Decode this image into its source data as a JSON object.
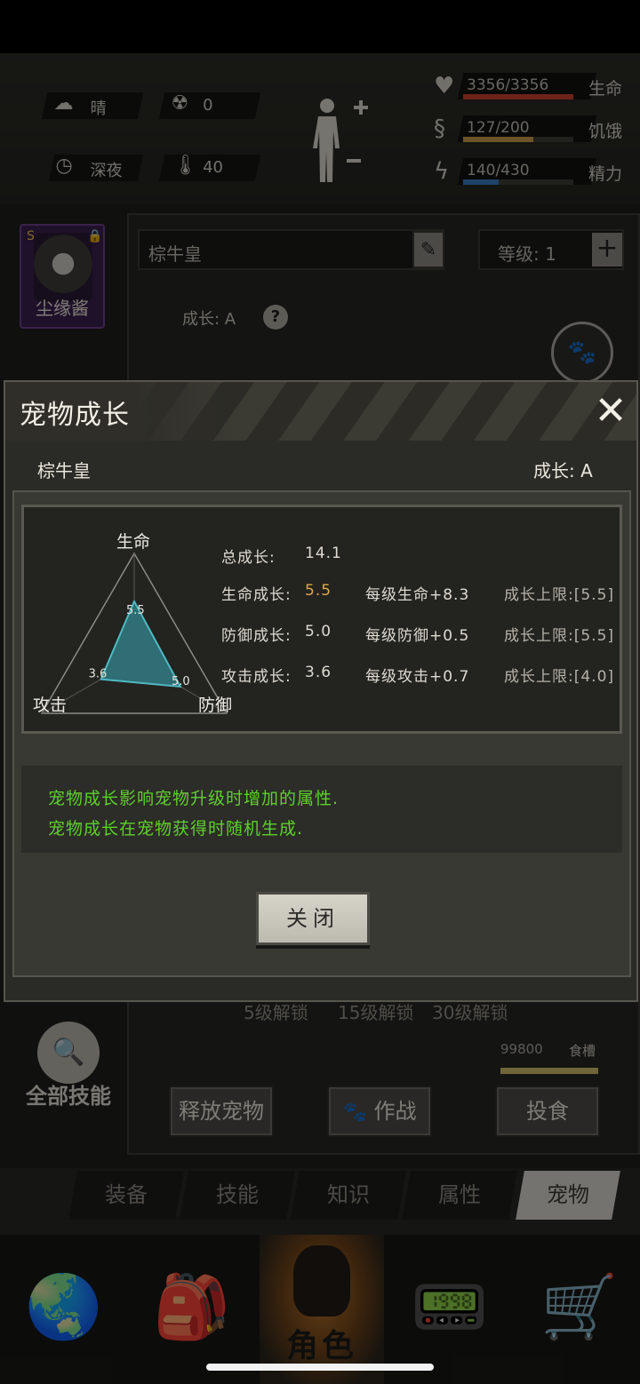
{
  "hud": {
    "weather": "晴",
    "radiation": "0",
    "time_of_day": "深夜",
    "temperature": "40",
    "stats": [
      {
        "label": "生命",
        "value": "3356/3356",
        "fraction": 1.0,
        "color": "#c8402e",
        "icon": "heart-icon"
      },
      {
        "label": "饥饿",
        "value": "127/200",
        "fraction": 0.635,
        "color": "#c59a4a",
        "icon": "stomach-icon"
      },
      {
        "label": "精力",
        "value": "140/430",
        "fraction": 0.326,
        "color": "#3a78c0",
        "icon": "energy-icon"
      }
    ]
  },
  "background_panel": {
    "pet_card_name": "尘缘酱",
    "name_field": "棕牛皇",
    "level_label": "等级: 1",
    "growth_label": "成长: A",
    "unlock_labels": [
      "5级解锁",
      "15级解锁",
      "30级解锁"
    ],
    "all_skills_label": "全部技能",
    "trough_value": "99800",
    "trough_label": "食槽",
    "buttons": {
      "release": "释放宠物",
      "battle": "作战",
      "feed": "投食"
    }
  },
  "tabs": [
    {
      "label": "装备",
      "active": false
    },
    {
      "label": "技能",
      "active": false
    },
    {
      "label": "知识",
      "active": false
    },
    {
      "label": "属性",
      "active": false
    },
    {
      "label": "宠物",
      "active": true
    }
  ],
  "nav": {
    "items": [
      {
        "name": "world-nav",
        "icon": "globe-icon",
        "glyph": "🌏"
      },
      {
        "name": "backpack-nav",
        "icon": "backpack-icon",
        "glyph": "🎒"
      },
      {
        "name": "character-nav",
        "icon": "head-icon",
        "label": "角色",
        "active": true
      },
      {
        "name": "radio-nav",
        "icon": "walkie-talkie-icon",
        "glyph": "📟"
      },
      {
        "name": "shop-nav",
        "icon": "cart-icon",
        "glyph": "🛒"
      }
    ]
  },
  "modal": {
    "title": "宠物成长",
    "pet_name": "棕牛皇",
    "grade": "成长: A",
    "total_label": "总成长:",
    "total_value": "14.1",
    "rows": [
      {
        "growth": "生命成长: ",
        "growth_value": "5.5",
        "per_level": "每级生命+8.3",
        "cap": "成长上限:[5.5]",
        "highlight": true
      },
      {
        "growth": "防御成长: ",
        "growth_value": "5.0",
        "per_level": "每级防御+0.5",
        "cap": "成长上限:[5.5]",
        "highlight": false
      },
      {
        "growth": "攻击成长: ",
        "growth_value": "3.6",
        "per_level": "每级攻击+0.7",
        "cap": "成长上限:[4.0]",
        "highlight": false
      }
    ],
    "radar": {
      "axes": [
        "生命",
        "防御",
        "攻击"
      ],
      "values": [
        5.5,
        5.0,
        3.6
      ],
      "labels": [
        "5.5",
        "5.0",
        "3.6"
      ],
      "max": 10,
      "fill_color": "#2e6e74",
      "stroke_color": "#4fb9c2"
    },
    "tips": [
      "宠物成长影响宠物升级时增加的属性.",
      "宠物成长在宠物获得时随机生成."
    ],
    "close_label": "关闭"
  }
}
